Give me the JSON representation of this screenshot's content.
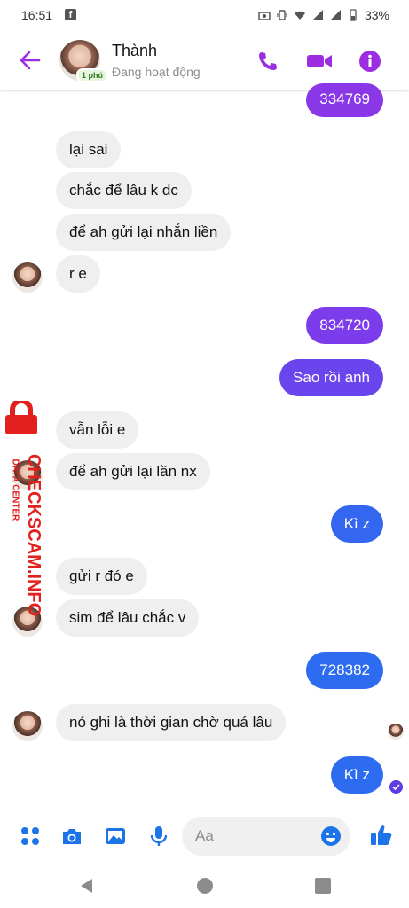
{
  "status_bar": {
    "time": "16:51",
    "fb_glyph": "f",
    "battery": "33%",
    "icons": [
      "facebook-notification-icon",
      "camera-icon",
      "vibrate-icon",
      "wifi-icon",
      "signal-icon",
      "signal-icon",
      "battery-icon"
    ]
  },
  "header": {
    "name": "Thành",
    "status": "Đang hoạt động",
    "active_badge": "1 phú"
  },
  "colors": {
    "accent": "#9c2de0",
    "outgoing_purple": "#8a37e8",
    "outgoing_blue": "#2d6cf0",
    "incoming": "#efefef"
  },
  "messages": [
    {
      "text": "334769",
      "dir": "out"
    },
    {
      "text": "lại sai",
      "dir": "in"
    },
    {
      "text": "chắc để lâu k dc",
      "dir": "in"
    },
    {
      "text": "để ah gửi lại nhắn liền",
      "dir": "in"
    },
    {
      "text": "r e",
      "dir": "in"
    },
    {
      "text": "834720",
      "dir": "out"
    },
    {
      "text": "Sao rồi anh",
      "dir": "out"
    },
    {
      "text": "vẫn lỗi e",
      "dir": "in"
    },
    {
      "text": "để ah gửi lại lần nx",
      "dir": "in"
    },
    {
      "text": "Kì z",
      "dir": "out"
    },
    {
      "text": "gửi r đó e",
      "dir": "in"
    },
    {
      "text": "sim để lâu chắc v",
      "dir": "in"
    },
    {
      "text": "728382",
      "dir": "out"
    },
    {
      "text": "nó ghi là thời gian chờ quá lâu",
      "dir": "in"
    },
    {
      "text": "Kì z",
      "dir": "out"
    }
  ],
  "watermark": {
    "site": "CHECKSCAM.INFO",
    "tagline": "DATA CENTER"
  },
  "composer": {
    "placeholder": "Aa"
  }
}
